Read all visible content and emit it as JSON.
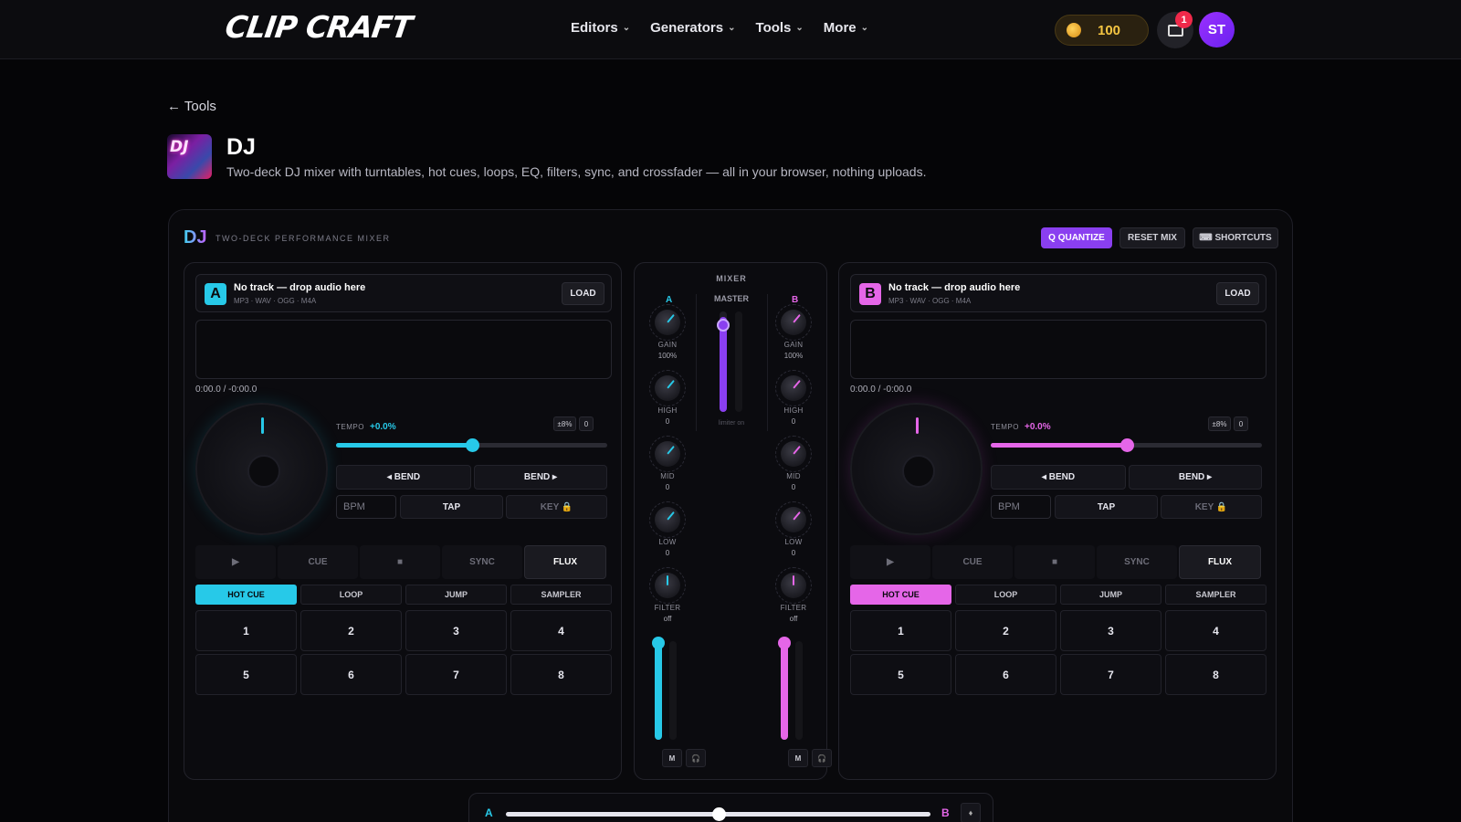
{
  "header": {
    "logo": "CLIP CRAFT",
    "nav": [
      "Editors",
      "Generators",
      "Tools",
      "More"
    ],
    "coins": "100",
    "notification_count": "1",
    "avatar_initials": "ST"
  },
  "page": {
    "back_label": "← Tools",
    "thumb_text": "DJ",
    "title": "DJ",
    "description": "Two-deck DJ mixer with turntables, hot cues, loops, EQ, filters, sync, and crossfader — all in your browser, nothing uploads."
  },
  "panel": {
    "title": "DJ",
    "subtitle": "TWO-DECK PERFORMANCE MIXER",
    "quantize_label": "Q QUANTIZE",
    "reset_label": "RESET MIX",
    "shortcuts_label": "⌨ SHORTCUTS"
  },
  "decks": [
    {
      "letter": "A",
      "color": "#27c9e8",
      "track_name": "No track — drop audio here",
      "formats": "MP3 · WAV · OGG · M4A",
      "load_label": "LOAD",
      "timecode": "0:00.0 / -0:00.0",
      "tempo_label": "TEMPO",
      "tempo_value": "+0.0%",
      "tempo_position": 0.5,
      "range_label": "±8%",
      "reset_label": "0",
      "bend_left": "◂ BEND",
      "bend_right": "BEND ▸",
      "bpm_placeholder": "BPM",
      "tap_label": "TAP",
      "key_label": "KEY 🔒",
      "transport": [
        "▶",
        "CUE",
        "■",
        "SYNC",
        "FLUX"
      ],
      "modes": [
        "HOT CUE",
        "LOOP",
        "JUMP",
        "SAMPLER"
      ],
      "active_mode": "HOT CUE",
      "pads": [
        "1",
        "2",
        "3",
        "4",
        "5",
        "6",
        "7",
        "8"
      ]
    },
    {
      "letter": "B",
      "color": "#e566e8",
      "track_name": "No track — drop audio here",
      "formats": "MP3 · WAV · OGG · M4A",
      "load_label": "LOAD",
      "timecode": "0:00.0 / -0:00.0",
      "tempo_label": "TEMPO",
      "tempo_value": "+0.0%",
      "tempo_position": 0.5,
      "range_label": "±8%",
      "reset_label": "0",
      "bend_left": "◂ BEND",
      "bend_right": "BEND ▸",
      "bpm_placeholder": "BPM",
      "tap_label": "TAP",
      "key_label": "KEY 🔒",
      "transport": [
        "▶",
        "CUE",
        "■",
        "SYNC",
        "FLUX"
      ],
      "modes": [
        "HOT CUE",
        "LOOP",
        "JUMP",
        "SAMPLER"
      ],
      "active_mode": "HOT CUE",
      "pads": [
        "1",
        "2",
        "3",
        "4",
        "5",
        "6",
        "7",
        "8"
      ]
    }
  ],
  "mixer": {
    "title": "MIXER",
    "master_label": "MASTER",
    "master_level": 1.0,
    "limiter_label": "limiter on",
    "channels": [
      {
        "letter": "A",
        "color": "#27c9e8",
        "knobs": [
          {
            "label": "GAIN",
            "value": "100%"
          },
          {
            "label": "HIGH",
            "value": "0"
          },
          {
            "label": "MID",
            "value": "0"
          },
          {
            "label": "LOW",
            "value": "0"
          },
          {
            "label": "FILTER",
            "value": "off"
          }
        ],
        "fader_level": 1.0,
        "mute_label": "M",
        "cue_label": "🎧"
      },
      {
        "letter": "B",
        "color": "#e566e8",
        "knobs": [
          {
            "label": "GAIN",
            "value": "100%"
          },
          {
            "label": "HIGH",
            "value": "0"
          },
          {
            "label": "MID",
            "value": "0"
          },
          {
            "label": "LOW",
            "value": "0"
          },
          {
            "label": "FILTER",
            "value": "off"
          }
        ],
        "fader_level": 1.0,
        "mute_label": "M",
        "cue_label": "🎧"
      }
    ]
  },
  "crossfader": {
    "left_label": "A",
    "right_label": "B",
    "position": 0.5,
    "button_label": "♦"
  },
  "colors": {
    "deck_a": "#27c9e8",
    "deck_b": "#e566e8",
    "accent": "#8a3ff0",
    "coin": "#f5c542"
  }
}
